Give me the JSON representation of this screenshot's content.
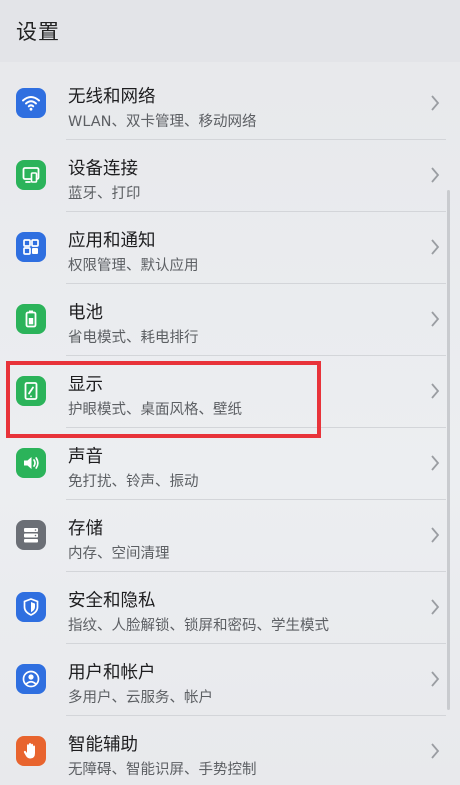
{
  "header": {
    "title": "设置"
  },
  "items": [
    {
      "title": "无线和网络",
      "subtitle": "WLAN、双卡管理、移动网络",
      "icon": "wifi-icon",
      "color": "#2f6fe0"
    },
    {
      "title": "设备连接",
      "subtitle": "蓝牙、打印",
      "icon": "device-connect-icon",
      "color": "#2bb35a"
    },
    {
      "title": "应用和通知",
      "subtitle": "权限管理、默认应用",
      "icon": "apps-icon",
      "color": "#2f6fe0"
    },
    {
      "title": "电池",
      "subtitle": "省电模式、耗电排行",
      "icon": "battery-icon",
      "color": "#2bb35a"
    },
    {
      "title": "显示",
      "subtitle": "护眼模式、桌面风格、壁纸",
      "icon": "display-icon",
      "color": "#2bb35a"
    },
    {
      "title": "声音",
      "subtitle": "免打扰、铃声、振动",
      "icon": "sound-icon",
      "color": "#2bb35a"
    },
    {
      "title": "存储",
      "subtitle": "内存、空间清理",
      "icon": "storage-icon",
      "color": "#6b6f76"
    },
    {
      "title": "安全和隐私",
      "subtitle": "指纹、人脸解锁、锁屏和密码、学生模式",
      "icon": "shield-icon",
      "color": "#2f6fe0"
    },
    {
      "title": "用户和帐户",
      "subtitle": "多用户、云服务、帐户",
      "icon": "user-icon",
      "color": "#2f6fe0"
    },
    {
      "title": "智能辅助",
      "subtitle": "无障碍、智能识屏、手势控制",
      "icon": "hand-icon",
      "color": "#e8642e"
    }
  ],
  "colors": {
    "highlight": "#e8333a",
    "blue": "#2f6fe0",
    "green": "#2bb35a",
    "gray": "#6b6f76",
    "orange": "#e8642e"
  }
}
